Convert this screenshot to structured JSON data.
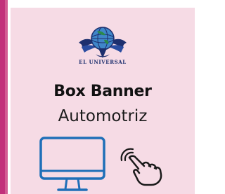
{
  "banner": {
    "brand_logo_text": "EL UNIVERSAL",
    "title": "Box Banner",
    "subtitle": "Automotriz"
  },
  "icons": {
    "logo": "el-universal-globe-eagle-logo",
    "device": "desktop-monitor-icon",
    "interaction": "tap-hand-icon"
  },
  "colors": {
    "accent_strip": "#c2307a",
    "card_background": "#f6dbe5",
    "icon_blue": "#1f6fb8",
    "brand_navy": "#1d2f6e",
    "title_text": "#111111"
  }
}
